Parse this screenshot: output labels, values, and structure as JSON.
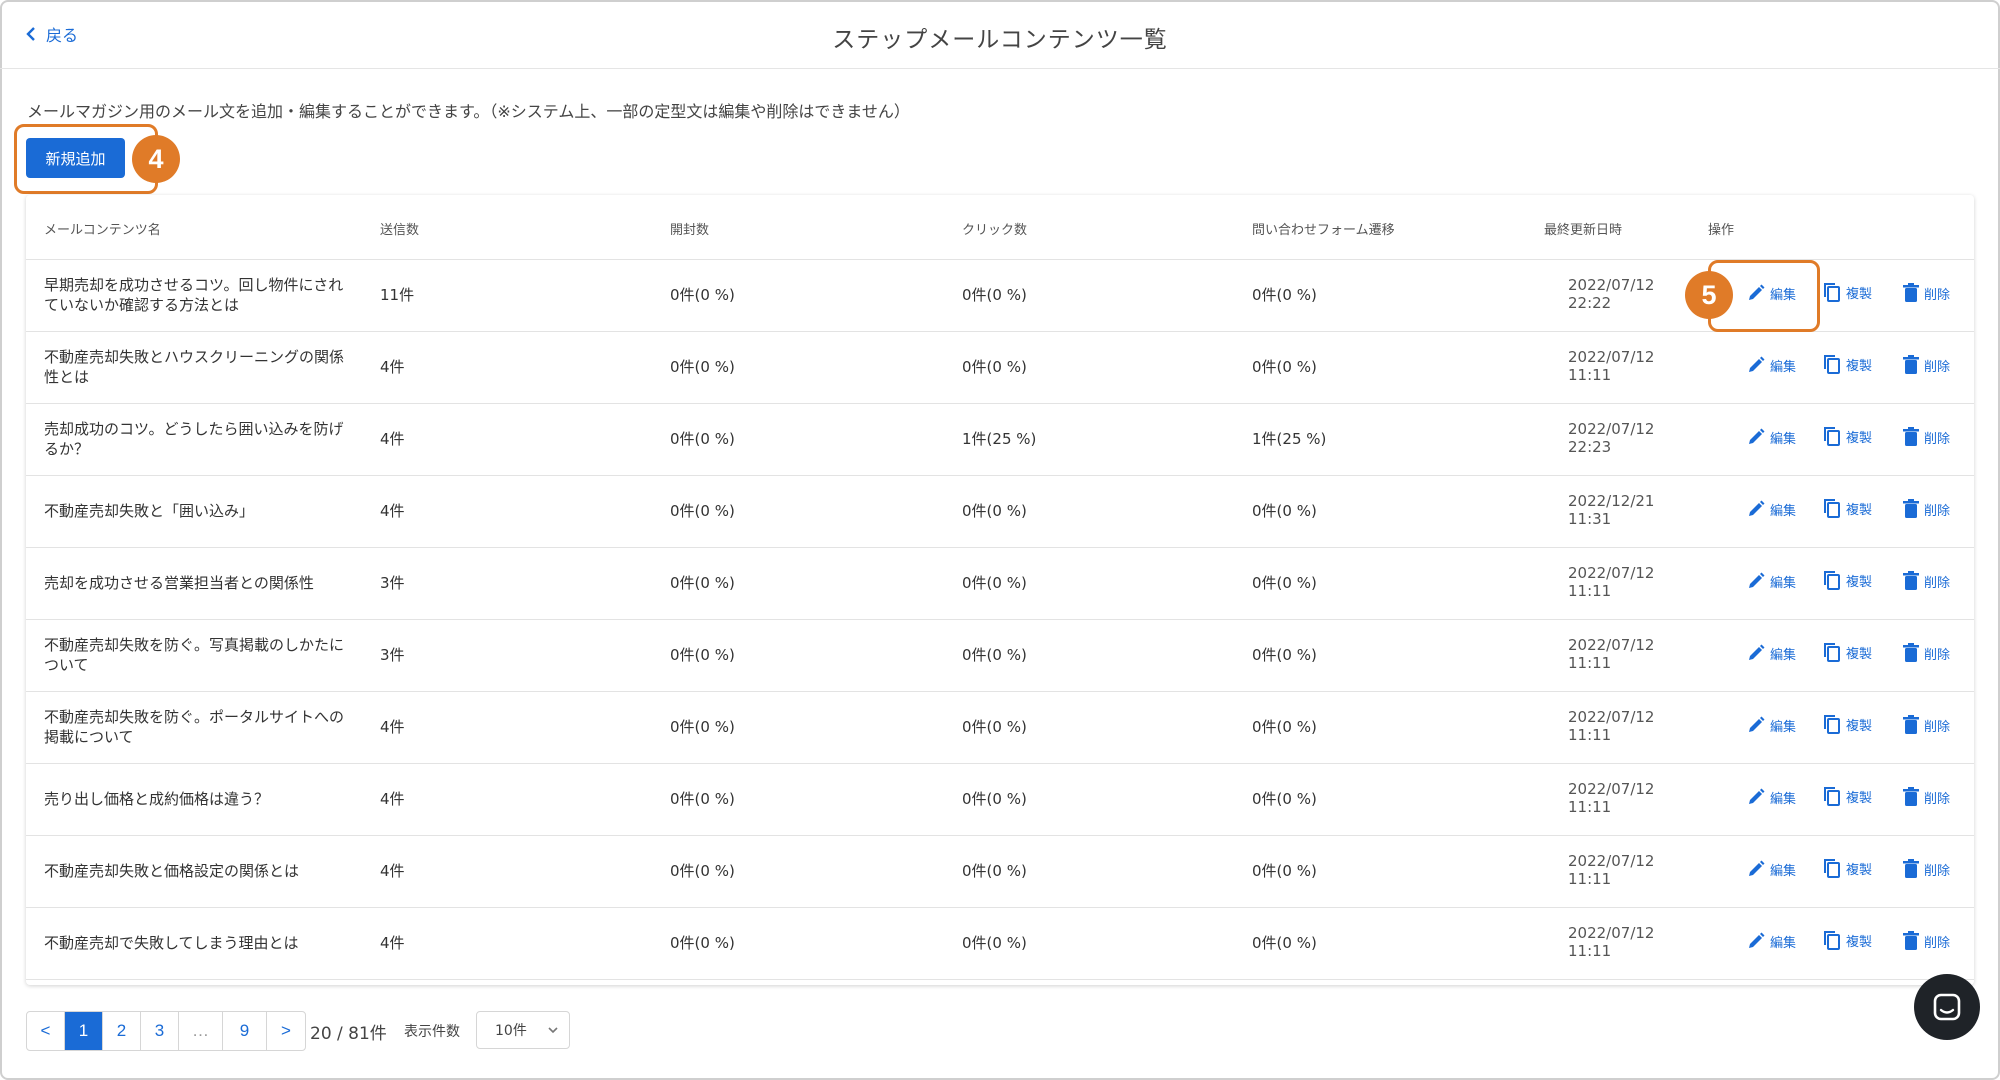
{
  "header": {
    "back_label": "戻る",
    "title": "ステップメールコンテンツ一覧"
  },
  "description": "メールマガジン用のメール文を追加・編集することができます。（※システム上、一部の定型文は編集や削除はできません）",
  "add_button_label": "新規追加",
  "callouts": {
    "step4": "4",
    "step5": "5",
    "color": "#e07b28"
  },
  "accent_color": "#1a6bd6",
  "table": {
    "columns": [
      "メールコンテンツ名",
      "送信数",
      "開封数",
      "クリック数",
      "問い合わせフォーム遷移",
      "最終更新日時",
      "操作"
    ],
    "actions": {
      "edit": "編集",
      "copy": "複製",
      "delete": "削除"
    },
    "rows": [
      {
        "name": "早期売却を成功させるコツ。回し物件にされていないか確認する方法とは",
        "sent": "11件",
        "opened": "0件(0 %)",
        "clicks": "0件(0 %)",
        "form": "0件(0 %)",
        "date": "2022/07/12",
        "time": "22:22"
      },
      {
        "name": "不動産売却失敗とハウスクリーニングの関係性とは",
        "sent": "4件",
        "opened": "0件(0 %)",
        "clicks": "0件(0 %)",
        "form": "0件(0 %)",
        "date": "2022/07/12",
        "time": "11:11"
      },
      {
        "name": "売却成功のコツ。どうしたら囲い込みを防げるか？",
        "sent": "4件",
        "opened": "0件(0 %)",
        "clicks": "1件(25 %)",
        "form": "1件(25 %)",
        "date": "2022/07/12",
        "time": "22:23"
      },
      {
        "name": "不動産売却失敗と「囲い込み」",
        "sent": "4件",
        "opened": "0件(0 %)",
        "clicks": "0件(0 %)",
        "form": "0件(0 %)",
        "date": "2022/12/21",
        "time": "11:31"
      },
      {
        "name": "売却を成功させる営業担当者との関係性",
        "sent": "3件",
        "opened": "0件(0 %)",
        "clicks": "0件(0 %)",
        "form": "0件(0 %)",
        "date": "2022/07/12",
        "time": "11:11"
      },
      {
        "name": "不動産売却失敗を防ぐ。写真掲載のしかたについて",
        "sent": "3件",
        "opened": "0件(0 %)",
        "clicks": "0件(0 %)",
        "form": "0件(0 %)",
        "date": "2022/07/12",
        "time": "11:11"
      },
      {
        "name": "不動産売却失敗を防ぐ。ポータルサイトへの掲載について",
        "sent": "4件",
        "opened": "0件(0 %)",
        "clicks": "0件(0 %)",
        "form": "0件(0 %)",
        "date": "2022/07/12",
        "time": "11:11"
      },
      {
        "name": "売り出し価格と成約価格は違う？",
        "sent": "4件",
        "opened": "0件(0 %)",
        "clicks": "0件(0 %)",
        "form": "0件(0 %)",
        "date": "2022/07/12",
        "time": "11:11"
      },
      {
        "name": "不動産売却失敗と価格設定の関係とは",
        "sent": "4件",
        "opened": "0件(0 %)",
        "clicks": "0件(0 %)",
        "form": "0件(0 %)",
        "date": "2022/07/12",
        "time": "11:11"
      },
      {
        "name": "不動産売却で失敗してしまう理由とは",
        "sent": "4件",
        "opened": "0件(0 %)",
        "clicks": "0件(0 %)",
        "form": "0件(0 %)",
        "date": "2022/07/12",
        "time": "11:11"
      }
    ]
  },
  "pagination": {
    "prev": "<",
    "next": ">",
    "pages": [
      "1",
      "2",
      "3",
      "…",
      "9"
    ],
    "current": "1",
    "count_text": "20 / 81件",
    "per_page_label": "表示件数",
    "per_page_value": "10件"
  },
  "icons": {
    "back": "chevron-left-icon",
    "edit": "pencil-icon",
    "copy": "copy-icon",
    "delete": "trash-icon",
    "chat": "chat-icon",
    "select": "chevron-down-icon"
  }
}
